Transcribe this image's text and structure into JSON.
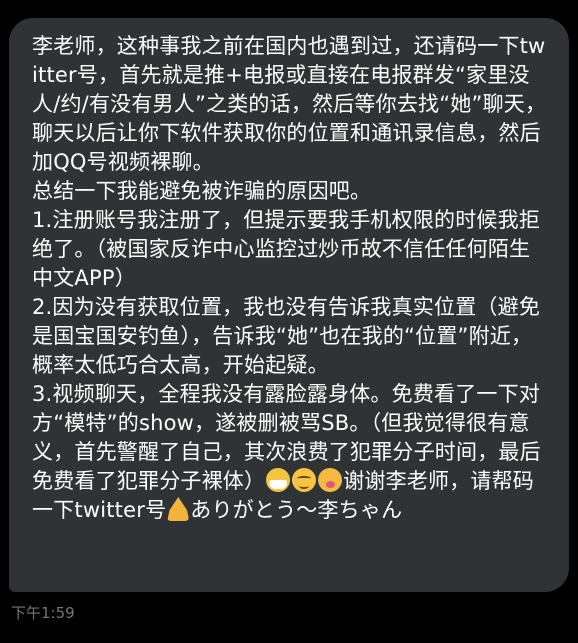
{
  "message": {
    "part1": "李老师，这种事我之前在国内也遇到过，还请码一下twitter号，首先就是推+电报或直接在电报群发“家里没人/约/有没有男人”之类的话，然后等你去找“她”聊天，聊天以后让你下软件获取你的位置和通讯录信息，然后加QQ号视频裸聊。\n总结一下我能避免被诈骗的原因吧。\n1.注册账号我注册了，但提示要我手机权限的时候我拒绝了。（被国家反诈中心监控过炒币故不信任任何陌生中文APP）\n2.因为没有获取位置，我也没有告诉我真实位置（避免是国宝国安钓鱼），告诉我“她”也在我的“位置”附近，概率太低巧合太高，开始起疑。\n3.视频聊天，全程我没有露脸露身体。免费看了一下对方“模特”的show，遂被删被骂SB。（但我觉得很有意义，首先警醒了自己，其次浪费了犯罪分子时间，最后免费看了犯罪分子裸体）",
    "emoji_1": "mask-face-icon",
    "emoji_2": "relieved-face-icon",
    "emoji_3": "drooling-face-icon",
    "part2": "谢谢李老师，请帮码一下twitter号",
    "emoji_4": "folded-hands-icon",
    "part3": "ありがとう～李ちゃん"
  },
  "timestamp": "下午1:59",
  "colors": {
    "background": "#000000",
    "bubble": "#2f3336",
    "text": "#ffffff",
    "timestamp": "#71767b"
  }
}
